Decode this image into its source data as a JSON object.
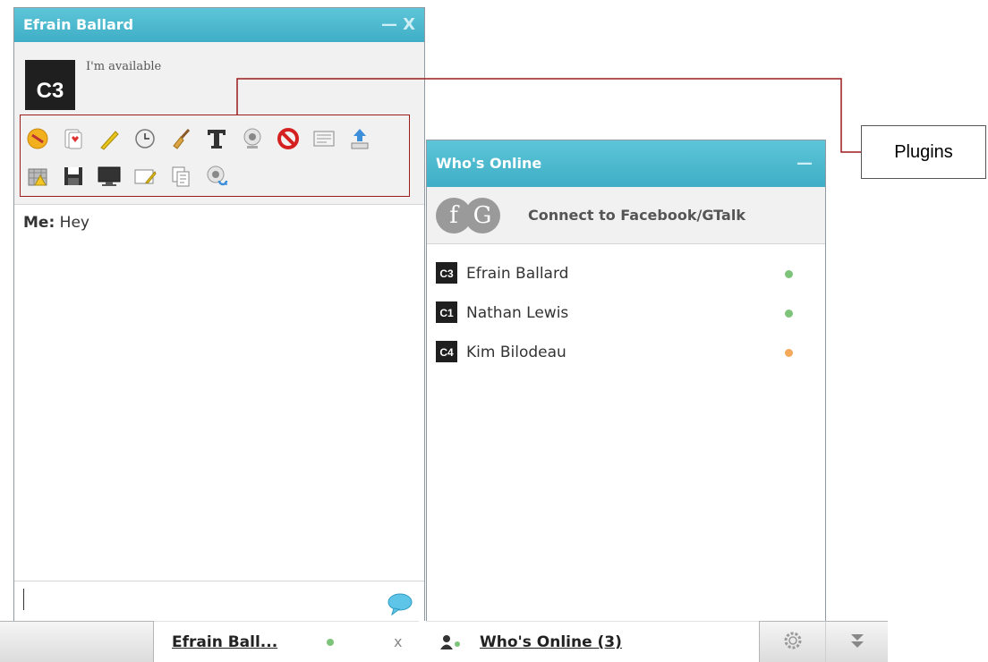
{
  "chat_window": {
    "title": "Efrain Ballard",
    "minimize_glyph": "—",
    "close_glyph": "X",
    "profile": {
      "avatar_label": "C3",
      "status": "I'm available"
    },
    "plugins_row_1": [
      "smilies-icon",
      "cards-icon",
      "pencil-icon",
      "clock-icon",
      "broom-icon",
      "text-format-icon",
      "webcam-icon",
      "block-icon",
      "report-icon",
      "upload-icon"
    ],
    "plugins_row_2": [
      "games-icon",
      "save-icon",
      "screenshare-icon",
      "whiteboard-icon",
      "translate-icon",
      "broadcast-icon"
    ],
    "messages": [
      {
        "sender": "Me:",
        "text": "Hey"
      }
    ]
  },
  "online_window": {
    "title": "Who's Online",
    "minimize_glyph": "—",
    "connect_label": "Connect to Facebook/GTalk",
    "fg_letters": [
      "f",
      "G"
    ],
    "contacts": [
      {
        "avatar": "C3",
        "name": "Efrain Ballard",
        "status_color": "#7ec37a"
      },
      {
        "avatar": "C1",
        "name": "Nathan Lewis",
        "status_color": "#7ec37a"
      },
      {
        "avatar": "C4",
        "name": "Kim Bilodeau",
        "status_color": "#f5a95a"
      }
    ]
  },
  "annotation": {
    "label": "Plugins"
  },
  "bottom_bar": {
    "chat_tab_label": "Efrain Ball...",
    "chat_tab_close": "x",
    "online_tab_label": "Who's Online (3)"
  },
  "colors": {
    "header": "#4bbad0",
    "online_dot": "#7ec37a",
    "away_dot": "#f5a95a",
    "annotation": "#9b1c1c"
  }
}
